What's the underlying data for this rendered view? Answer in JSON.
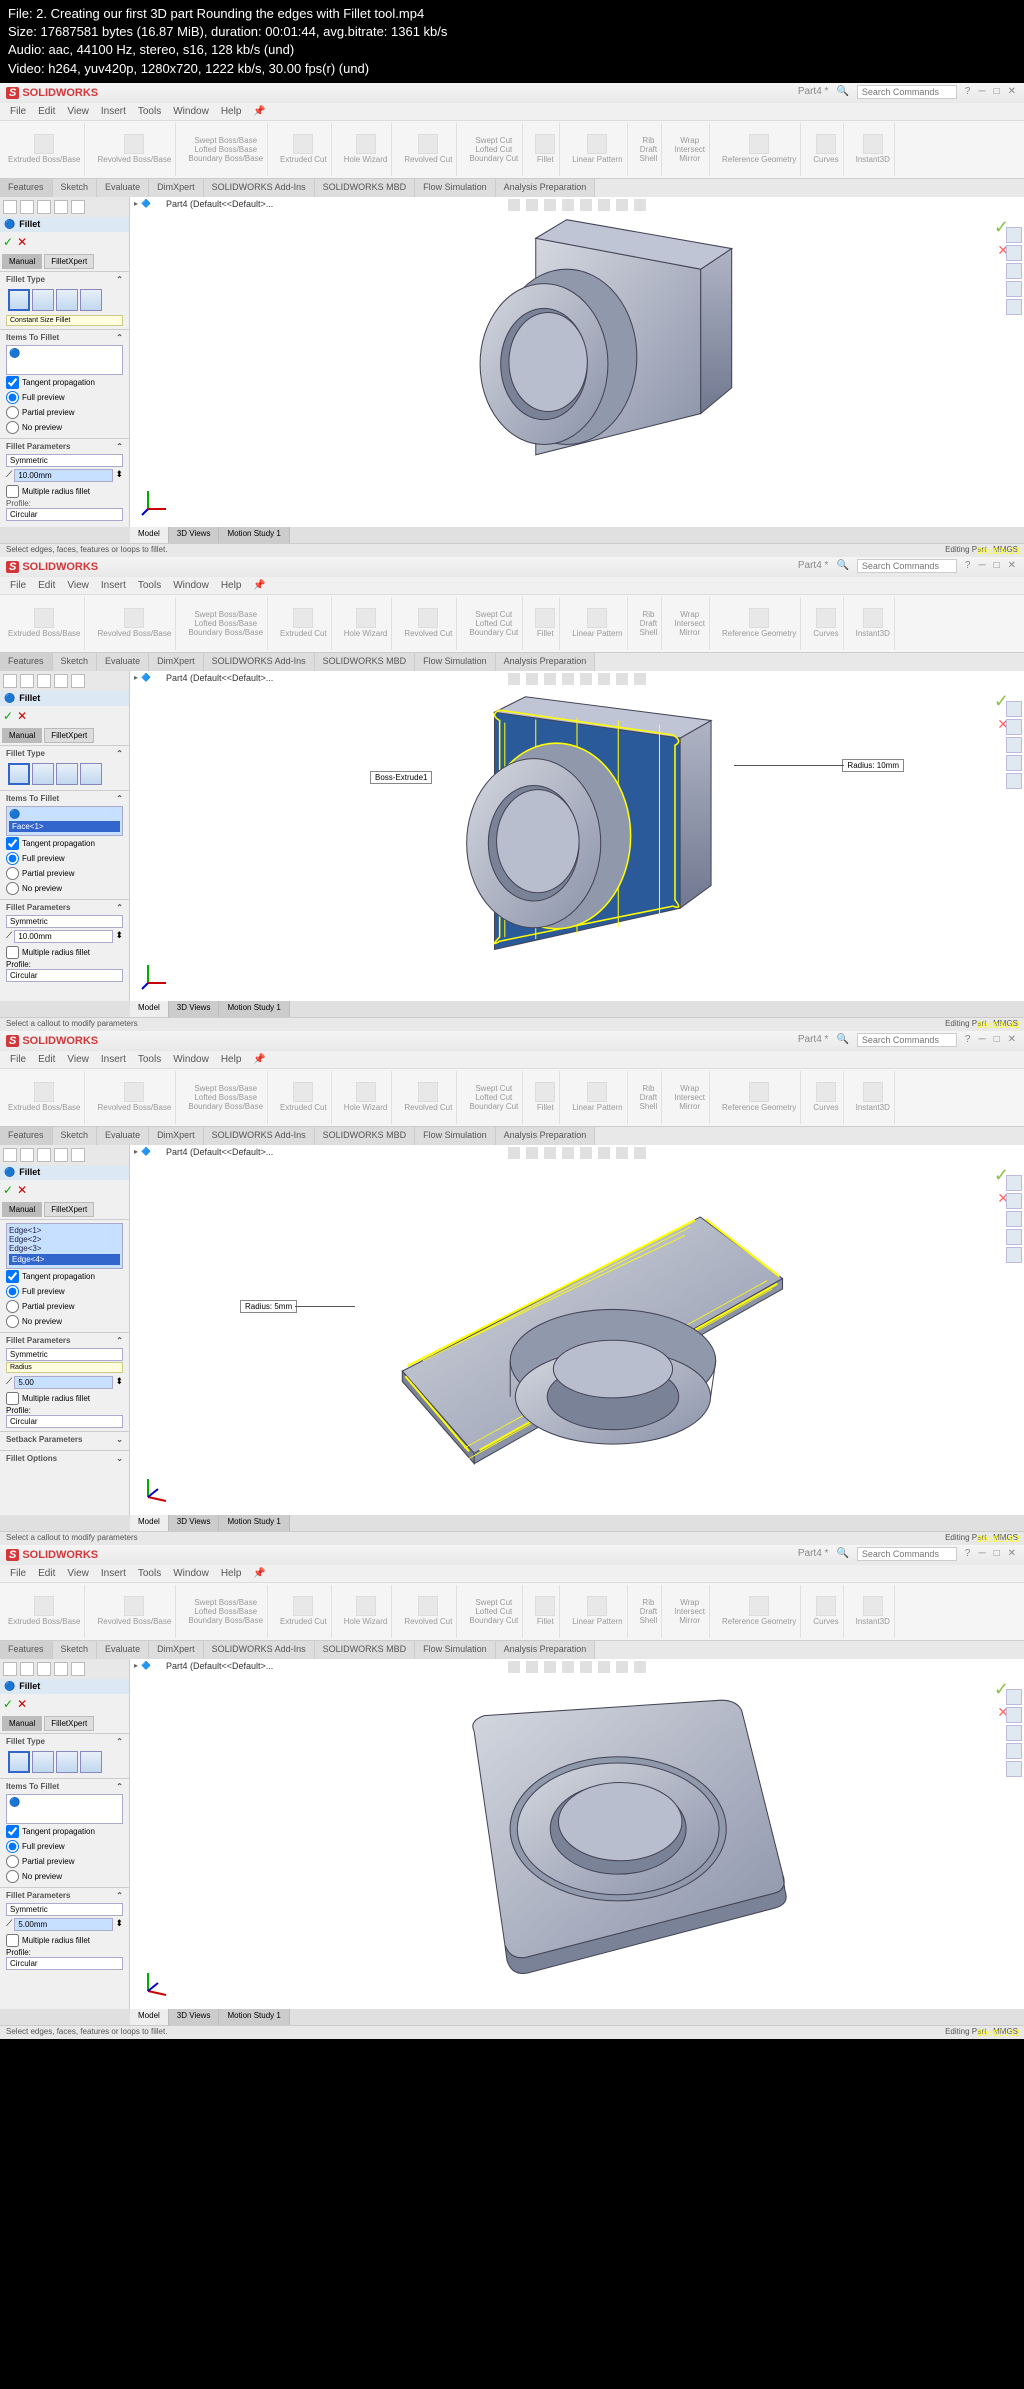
{
  "fileinfo": {
    "l1": "File: 2. Creating our first 3D part Rounding the edges with Fillet tool.mp4",
    "l2": "Size: 17687581 bytes (16.87 MiB), duration: 00:01:44, avg.bitrate: 1361 kb/s",
    "l3": "Audio: aac, 44100 Hz, stereo, s16, 128 kb/s (und)",
    "l4": "Video: h264, yuv420p, 1280x720, 1222 kb/s, 30.00 fps(r) (und)"
  },
  "app": "SOLIDWORKS",
  "menus": [
    "File",
    "Edit",
    "View",
    "Insert",
    "Tools",
    "Window",
    "Help"
  ],
  "doc": "Part4 *",
  "search_ph": "Search Commands",
  "ribbon": {
    "g1": [
      "Extruded Boss/Base",
      "Revolved Boss/Base"
    ],
    "g1b": [
      "Swept Boss/Base",
      "Lofted Boss/Base",
      "Boundary Boss/Base"
    ],
    "g2": [
      "Extruded Cut",
      "Hole Wizard",
      "Revolved Cut"
    ],
    "g2b": [
      "Swept Cut",
      "Lofted Cut",
      "Boundary Cut"
    ],
    "g3": [
      "Fillet",
      "Linear Pattern"
    ],
    "g3b": [
      "Rib",
      "Draft",
      "Shell"
    ],
    "g3c": [
      "Wrap",
      "Intersect",
      "Mirror"
    ],
    "g4": [
      "Reference Geometry",
      "Curves"
    ],
    "g5": "Instant3D"
  },
  "tabs": [
    "Features",
    "Sketch",
    "Evaluate",
    "DimXpert",
    "SOLIDWORKS Add-Ins",
    "SOLIDWORKS MBD",
    "Flow Simulation",
    "Analysis Preparation"
  ],
  "part_path": "Part4 (Default<<Default>...",
  "feature_name": "Fillet",
  "subtabs": [
    "Manual",
    "FilletXpert"
  ],
  "sections": {
    "fillet_type": "Fillet Type",
    "items": "Items To Fillet",
    "params": "Fillet Parameters",
    "profile": "Profile:",
    "setback": "Setback Parameters",
    "options": "Fillet Options"
  },
  "fillet_tip": "Constant Size Fillet",
  "options": {
    "tangent": "Tangent propagation",
    "full": "Full preview",
    "partial": "Partial preview",
    "none": "No preview",
    "multi": "Multiple radius fillet"
  },
  "param_vals": {
    "symmetric": "Symmetric",
    "circular": "Circular"
  },
  "shots": [
    {
      "radius": "10.00mm",
      "items": [],
      "status": "Select edges, faces, features or loops to fillet.",
      "ts": "00:00:23",
      "callout": "",
      "tip": "Constant Size Fillet"
    },
    {
      "radius": "10.00mm",
      "items": [
        "Face<1>"
      ],
      "status": "Select a callout to modify parameters",
      "ts": "00:00:42",
      "callout": "Radius: 10mm",
      "callout2": "Boss-Extrude1"
    },
    {
      "radius": "5.00",
      "items": [
        "Edge<1>",
        "Edge<2>",
        "Edge<3>",
        "Edge<4>"
      ],
      "status": "Select a callout to modify parameters",
      "ts": "00:01:02",
      "callout": "Radius: 5mm",
      "tip": "Radius"
    },
    {
      "radius": "5.00mm",
      "items": [],
      "status": "Select edges, faces, features or loops to fillet.",
      "ts": "00:01:32",
      "callout": ""
    }
  ],
  "btabs": [
    "Model",
    "3D Views",
    "Motion Study 1"
  ],
  "status_right": [
    "Editing Part",
    "MMGS"
  ]
}
